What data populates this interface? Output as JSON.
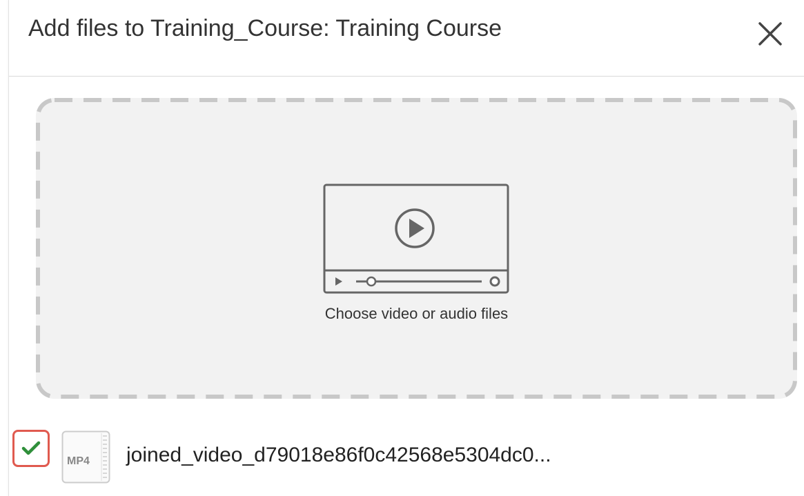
{
  "dialog": {
    "title": "Add files to Training_Course: Training Course",
    "close_icon": "close-icon"
  },
  "dropzone": {
    "label": "Choose video or audio files",
    "icon": "video-player-icon"
  },
  "file": {
    "name": "joined_video_d79018e86f0c42568e5304dc0...",
    "type_label": "MP4",
    "checked": true,
    "check_icon": "checkmark-icon"
  },
  "colors": {
    "check_border": "#e05a4f",
    "check_mark": "#2f8f3a",
    "dash_border": "#c8c8c8",
    "dropzone_bg": "#f2f2f2"
  }
}
